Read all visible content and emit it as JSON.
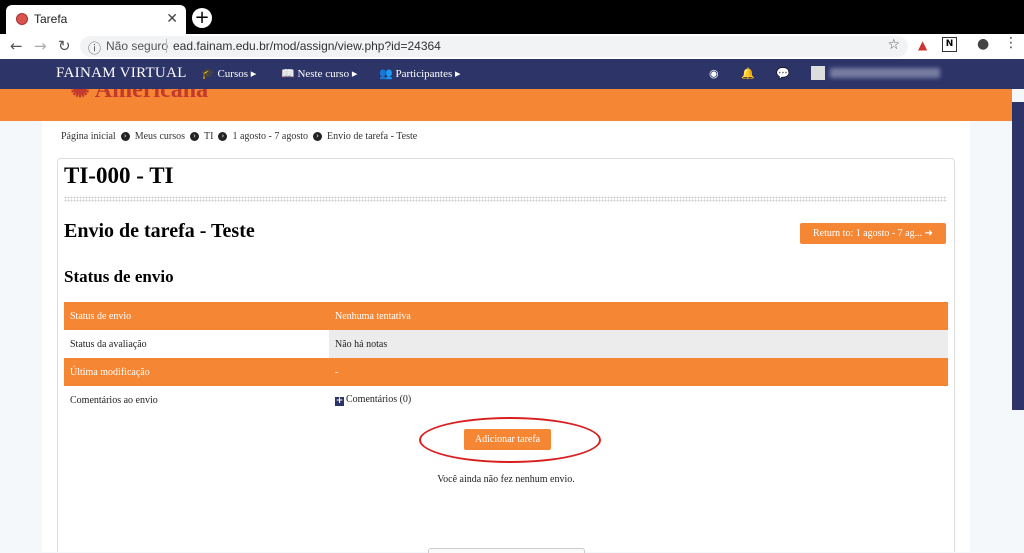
{
  "browser": {
    "tab_title": "Tarefa",
    "tab_close": "✕",
    "new_tab": "+",
    "security_label": "Não seguro",
    "url": "ead.fainam.edu.br/mod/assign/view.php?id=24364"
  },
  "navbar": {
    "brand": "FAINAM VIRTUAL",
    "menus": [
      "Cursos",
      "Neste curso",
      "Participantes"
    ]
  },
  "breadcrumb": [
    "Página inicial",
    "Meus cursos",
    "TI",
    "1 agosto - 7 agosto",
    "Envio de tarefa - Teste"
  ],
  "course_title": "TI-000 - TI",
  "page_title": "Envio de tarefa - Teste",
  "return_button": "Return to: 1 agosto - 7 ag...",
  "section_title": "Status de envio",
  "status_table": [
    {
      "label": "Status de envio",
      "value": "Nenhuma tentativa"
    },
    {
      "label": "Status da avaliação",
      "value": "Não há notas"
    },
    {
      "label": "Última modificação",
      "value": "-"
    },
    {
      "label": "Comentários ao envio",
      "value": "Comentários (0)"
    }
  ],
  "add_button": "Adicionar tarefa",
  "no_submission": "Você ainda não fez nenhum envio.",
  "colors": {
    "accent": "#f58634",
    "navbar": "#2c3468",
    "highlight": "#d81e1e"
  }
}
